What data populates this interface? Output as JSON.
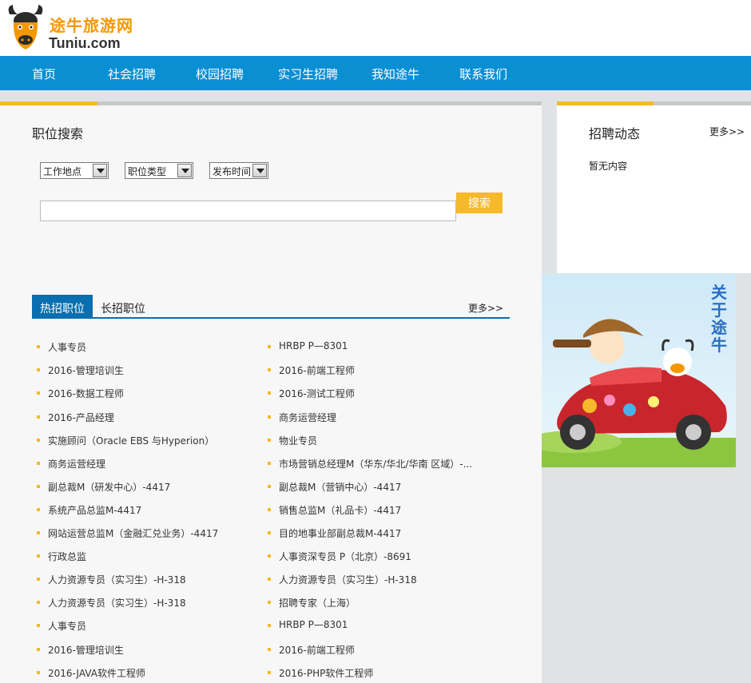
{
  "logo": {
    "cn": "途牛旅游网",
    "en": "Tuniu.com"
  },
  "nav": [
    "首页",
    "社会招聘",
    "校园招聘",
    "实习生招聘",
    "我知途牛",
    "联系我们"
  ],
  "search": {
    "title": "职位搜索",
    "selects": [
      "工作地点",
      "职位类型",
      "发布时间"
    ],
    "input_value": "",
    "button": "搜索"
  },
  "jobs": {
    "tabs": [
      "热招职位",
      "长招职位"
    ],
    "more": "更多>>",
    "left": [
      "人事专员",
      "2016-管理培训生",
      "2016-数据工程师",
      "2016-产品经理",
      "实施顾问（Oracle EBS 与Hyperion）",
      "商务运营经理",
      "副总裁M（研发中心）-4417",
      "系统产品总监M-4417",
      "网站运营总监M（金融汇兑业务）-4417",
      "行政总监",
      "人力资源专员（实习生）-H-318",
      "人力资源专员（实习生）-H-318",
      "人事专员",
      "2016-管理培训生",
      "2016-JAVA软件工程师"
    ],
    "right": [
      "HRBP P—8301",
      "2016-前端工程师",
      "2016-测试工程师",
      "商务运营经理",
      "物业专员",
      "市场营销总经理M（华东/华北/华南 区域）-...",
      "副总裁M（营销中心）-4417",
      "销售总监M（礼品卡）-4417",
      "目的地事业部副总裁M-4417",
      "人事资深专员 P（北京）-8691",
      "人力资源专员（实习生）-H-318",
      "招聘专家（上海）",
      "HRBP P—8301",
      "2016-前端工程师",
      "2016-PHP软件工程师"
    ]
  },
  "sidebar": {
    "title": "招聘动态",
    "more": "更多>>",
    "empty": "暂无内容"
  },
  "banner": {
    "text": "关于途牛"
  }
}
